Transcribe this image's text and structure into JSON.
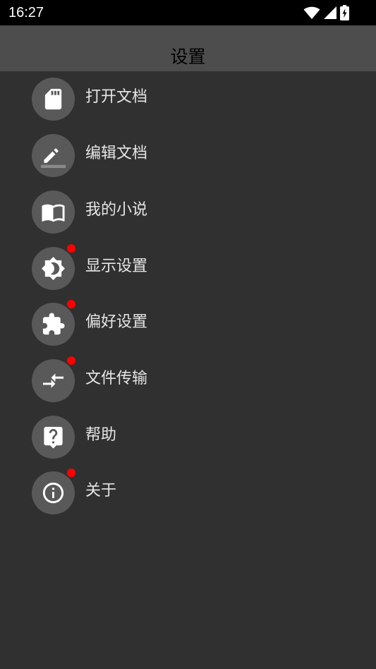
{
  "status_bar": {
    "time": "16:27",
    "icons": [
      "wifi-icon",
      "signal-icon",
      "battery-charging-icon"
    ]
  },
  "app_bar": {
    "title": "设置"
  },
  "menu": {
    "items": [
      {
        "label": "打开文档",
        "icon": "sd-card-icon",
        "badge": false
      },
      {
        "label": "编辑文档",
        "icon": "pencil-icon",
        "badge": false
      },
      {
        "label": "我的小说",
        "icon": "book-icon",
        "badge": false
      },
      {
        "label": "显示设置",
        "icon": "brightness-icon",
        "badge": true
      },
      {
        "label": "偏好设置",
        "icon": "puzzle-icon",
        "badge": true
      },
      {
        "label": "文件传输",
        "icon": "transfer-icon",
        "badge": true
      },
      {
        "label": "帮助",
        "icon": "help-icon",
        "badge": false
      },
      {
        "label": "关于",
        "icon": "info-icon",
        "badge": true
      }
    ]
  },
  "colors": {
    "background": "#303030",
    "app_bar": "#4d4d4d",
    "icon_circle": "#595959",
    "badge": "#ff0000",
    "label": "#e6e6e6"
  }
}
